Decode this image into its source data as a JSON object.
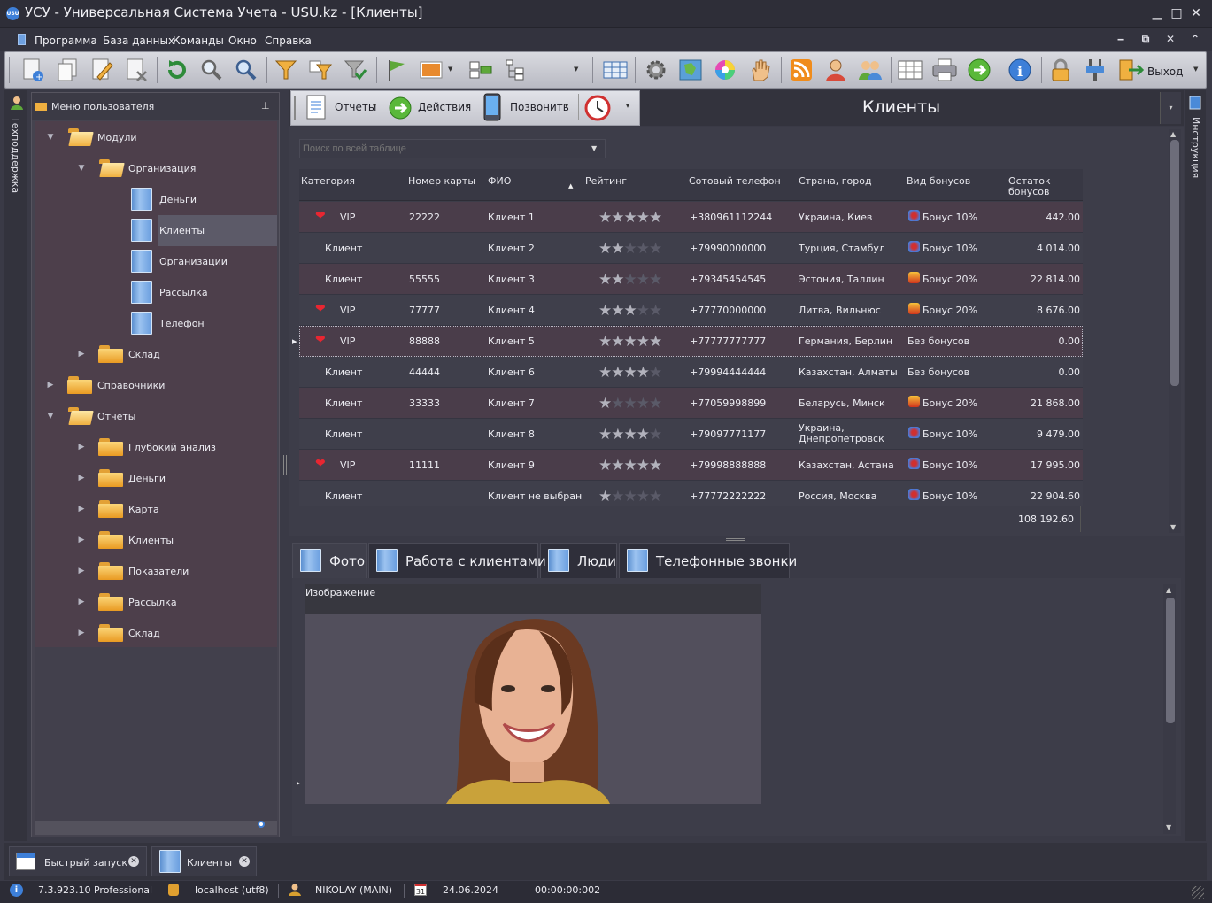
{
  "window": {
    "title": "УСУ - Универсальная Система Учета - USU.kz - [Клиенты]",
    "logo_text": "USU",
    "minimize": "▁",
    "maximize": "□",
    "close": "✕"
  },
  "menu": {
    "items": [
      "Программа",
      "База данных",
      "Команды",
      "Окно",
      "Справка"
    ],
    "mdi_minimize": "‒",
    "mdi_restore": "⧉",
    "mdi_close": "✕",
    "mdi_pin": "⌃"
  },
  "toolbar": {
    "exit_label": "Выход",
    "icons": [
      "new-record-icon",
      "copy-icon",
      "edit-icon",
      "delete-icon",
      "refresh-icon",
      "search-icon",
      "advanced-search-icon",
      "filter-icon",
      "filter-add-icon",
      "filter-clear-icon",
      "flag-icon",
      "image-icon",
      "group-icon",
      "tree-icon",
      "grid-icon",
      "settings-icon",
      "map-icon",
      "color-icon",
      "hand-icon",
      "rss-icon",
      "user-icon",
      "users-icon",
      "table-icon",
      "print-icon",
      "next-icon",
      "info-icon",
      "lock-icon",
      "plugin-icon",
      "exit-icon"
    ]
  },
  "left_strip": {
    "label": "Техподдержка"
  },
  "right_strip": {
    "label": "Инструкция"
  },
  "nav": {
    "header": "Меню пользователя",
    "pin": "⊥",
    "tree": [
      {
        "label": "Модули",
        "level": 0,
        "type": "folder-open",
        "arrow": "▼"
      },
      {
        "label": "Организация",
        "level": 1,
        "type": "folder-open",
        "arrow": "▼"
      },
      {
        "label": "Деньги",
        "level": 2,
        "type": "doc"
      },
      {
        "label": "Клиенты",
        "level": 2,
        "type": "doc",
        "selected": true
      },
      {
        "label": "Организации",
        "level": 2,
        "type": "doc"
      },
      {
        "label": "Рассылка",
        "level": 2,
        "type": "doc"
      },
      {
        "label": "Телефон",
        "level": 2,
        "type": "doc"
      },
      {
        "label": "Склад",
        "level": 1,
        "type": "folder",
        "arrow": "▶"
      },
      {
        "label": "Справочники",
        "level": 0,
        "type": "folder",
        "arrow": "▶"
      },
      {
        "label": "Отчеты",
        "level": 0,
        "type": "folder-open",
        "arrow": "▼"
      },
      {
        "label": "Глубокий анализ",
        "level": 1,
        "type": "folder",
        "arrow": "▶"
      },
      {
        "label": "Деньги",
        "level": 1,
        "type": "folder",
        "arrow": "▶"
      },
      {
        "label": "Карта",
        "level": 1,
        "type": "folder",
        "arrow": "▶"
      },
      {
        "label": "Клиенты",
        "level": 1,
        "type": "folder",
        "arrow": "▶"
      },
      {
        "label": "Показатели",
        "level": 1,
        "type": "folder",
        "arrow": "▶"
      },
      {
        "label": "Рассылка",
        "level": 1,
        "type": "folder",
        "arrow": "▶"
      },
      {
        "label": "Склад",
        "level": 1,
        "type": "folder",
        "arrow": "▶"
      }
    ]
  },
  "subtoolbar": {
    "reports": "Отчеты",
    "actions": "Действия",
    "call": "Позвонить",
    "dropdown_arrow": "▾"
  },
  "center": {
    "title": "Клиенты"
  },
  "grid": {
    "search_placeholder": "Поиск по всей таблице",
    "sort_indicator": "▲",
    "columns": [
      "Категория",
      "Номер карты",
      "ФИО",
      "Рейтинг",
      "Сотовый телефон",
      "Страна, город",
      "Вид бонусов",
      "Остаток бонусов"
    ],
    "rows": [
      {
        "vip": true,
        "category": "VIP",
        "card": "22222",
        "name": "Клиент 1",
        "rating": 5,
        "phone": "+380961112244",
        "city": "Украина, Киев",
        "bonus": "Бонус 10%",
        "bonus_icon": "bonus10-icon",
        "balance": "442.00"
      },
      {
        "vip": false,
        "category": "Клиент",
        "card": "",
        "name": "Клиент 2",
        "rating": 2,
        "phone": "+79990000000",
        "city": "Турция, Стамбул",
        "bonus": "Бонус 10%",
        "bonus_icon": "bonus10-icon",
        "balance": "4 014.00"
      },
      {
        "vip": false,
        "category": "Клиент",
        "card": "55555",
        "name": "Клиент 3",
        "rating": 2,
        "phone": "+79345454545",
        "city": "Эстония, Таллин",
        "bonus": "Бонус 20%",
        "bonus_icon": "bonus20-icon",
        "balance": "22 814.00"
      },
      {
        "vip": true,
        "category": "VIP",
        "card": "77777",
        "name": "Клиент 4",
        "rating": 3,
        "phone": "+77770000000",
        "city": "Литва, Вильнюс",
        "bonus": "Бонус 20%",
        "bonus_icon": "bonus20-icon",
        "balance": "8 676.00"
      },
      {
        "vip": true,
        "category": "VIP",
        "card": "88888",
        "name": "Клиент 5",
        "rating": 5,
        "phone": "+77777777777",
        "city": "Германия, Берлин",
        "bonus": "Без бонусов",
        "bonus_icon": "",
        "balance": "0.00"
      },
      {
        "vip": false,
        "category": "Клиент",
        "card": "44444",
        "name": "Клиент 6",
        "rating": 4,
        "phone": "+79994444444",
        "city": "Казахстан, Алматы",
        "bonus": "Без бонусов",
        "bonus_icon": "",
        "balance": "0.00"
      },
      {
        "vip": false,
        "category": "Клиент",
        "card": "33333",
        "name": "Клиент 7",
        "rating": 1,
        "phone": "+77059998899",
        "city": "Беларусь, Минск",
        "bonus": "Бонус 20%",
        "bonus_icon": "bonus20-icon",
        "balance": "21 868.00"
      },
      {
        "vip": false,
        "category": "Клиент",
        "card": "",
        "name": "Клиент 8",
        "rating": 4,
        "phone": "+79097771177",
        "city": "Украина,\nДнепропетровск",
        "bonus": "Бонус 10%",
        "bonus_icon": "bonus10-icon",
        "balance": "9 479.00"
      },
      {
        "vip": true,
        "category": "VIP",
        "card": "11111",
        "name": "Клиент 9",
        "rating": 5,
        "phone": "+79998888888",
        "city": "Казахстан, Астана",
        "bonus": "Бонус 10%",
        "bonus_icon": "bonus10-icon",
        "balance": "17 995.00"
      },
      {
        "vip": false,
        "category": "Клиент",
        "card": "",
        "name": "Клиент не выбран",
        "rating": 1,
        "phone": "+77772222222",
        "city": "Россия, Москва",
        "bonus": "Бонус 10%",
        "bonus_icon": "bonus10-icon",
        "balance": "22 904.60"
      }
    ],
    "total": "108 192.60",
    "selected_row": 4,
    "row_indicator": "▸"
  },
  "detail": {
    "tabs": [
      "Фото",
      "Работа с клиентами",
      "Люди",
      "Телефонные звонки"
    ],
    "active_tab": 0,
    "image_label": "Изображение"
  },
  "taskbar": {
    "tasks": [
      "Быстрый запуск",
      "Клиенты"
    ],
    "close_glyph": "✕"
  },
  "status": {
    "version": "7.3.923.10 Professional",
    "db": "localhost (utf8)",
    "user": "NIKOLAY (MAIN)",
    "date": "24.06.2024",
    "timer": "00:00:00:002",
    "calendar_day": "31"
  },
  "colors": {
    "accent": "#3d7fd8",
    "vip_heart": "#e82631",
    "row_odd": "#4a3d4a",
    "row_even": "#3f3f4b",
    "folder": "#f0b040"
  }
}
